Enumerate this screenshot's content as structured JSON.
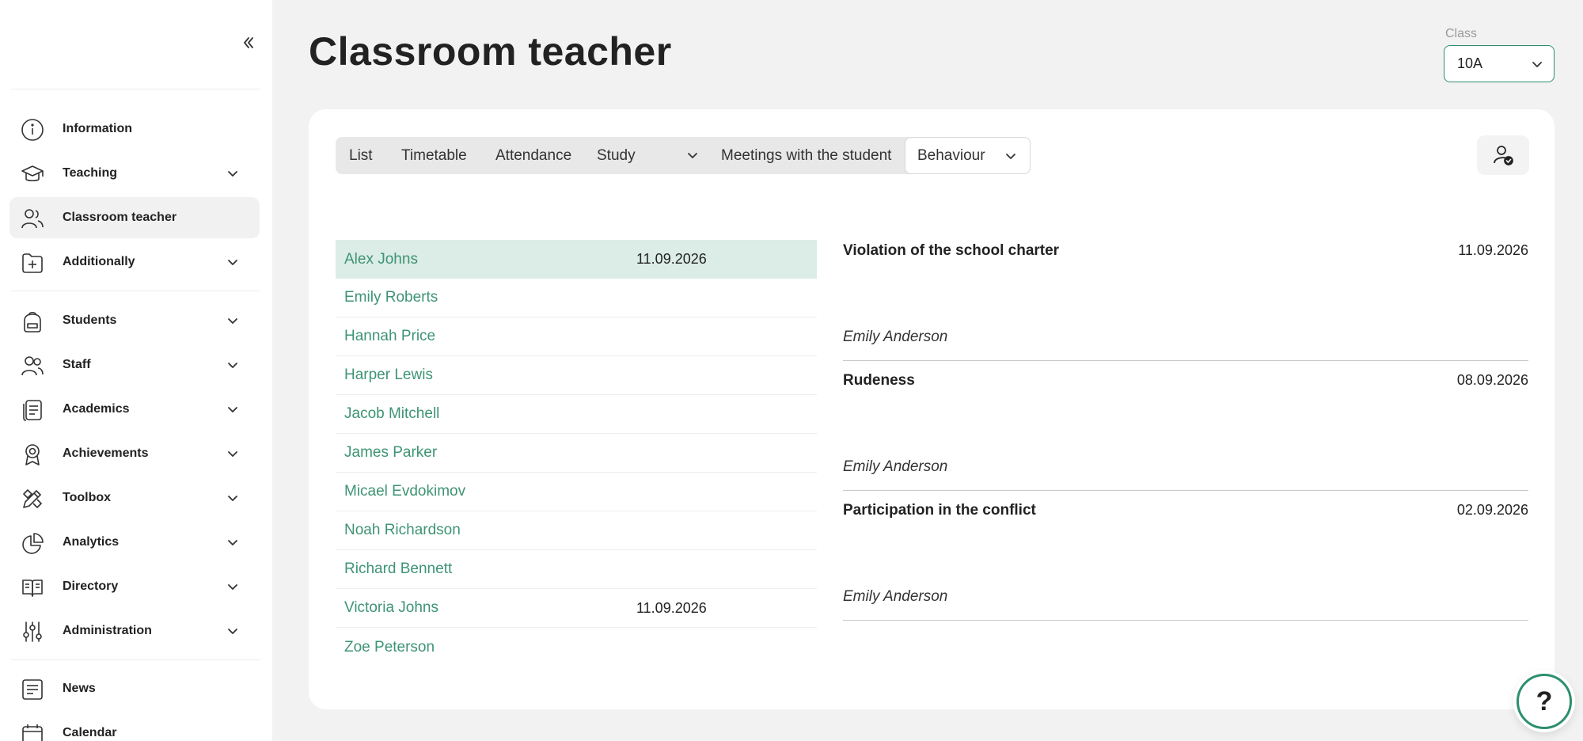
{
  "sidebar": {
    "items": [
      {
        "label": "Information",
        "icon": "info-icon"
      },
      {
        "label": "Teaching",
        "icon": "graduation-cap-icon"
      },
      {
        "label": "Classroom teacher",
        "icon": "classroom-teacher-icon"
      },
      {
        "label": "Additionally",
        "icon": "folder-plus-icon"
      },
      {
        "label": "Students",
        "icon": "backpack-icon"
      },
      {
        "label": "Staff",
        "icon": "users-icon"
      },
      {
        "label": "Academics",
        "icon": "document-icon"
      },
      {
        "label": "Achievements",
        "icon": "award-icon"
      },
      {
        "label": "Toolbox",
        "icon": "tools-icon"
      },
      {
        "label": "Analytics",
        "icon": "pie-chart-icon"
      },
      {
        "label": "Directory",
        "icon": "book-open-icon"
      },
      {
        "label": "Administration",
        "icon": "sliders-icon"
      },
      {
        "label": "News",
        "icon": "news-icon"
      },
      {
        "label": "Calendar",
        "icon": "calendar-icon"
      }
    ]
  },
  "header": {
    "title": "Classroom teacher",
    "class_label": "Class",
    "class_value": "10A"
  },
  "tabs": {
    "list": "List",
    "timetable": "Timetable",
    "attendance": "Attendance",
    "study": "Study",
    "meetings": "Meetings with the student",
    "behaviour": "Behaviour"
  },
  "students": [
    {
      "name": "Alex Johns",
      "date": "11.09.2026"
    },
    {
      "name": "Emily Roberts",
      "date": ""
    },
    {
      "name": "Hannah Price",
      "date": ""
    },
    {
      "name": "Harper Lewis",
      "date": ""
    },
    {
      "name": "Jacob Mitchell",
      "date": ""
    },
    {
      "name": "James Parker",
      "date": ""
    },
    {
      "name": "Micael Evdokimov",
      "date": ""
    },
    {
      "name": "Noah Richardson",
      "date": ""
    },
    {
      "name": "Richard Bennett",
      "date": ""
    },
    {
      "name": "Victoria Johns",
      "date": "11.09.2026"
    },
    {
      "name": "Zoe Peterson",
      "date": ""
    }
  ],
  "records": [
    {
      "title": "Violation of the school charter",
      "date": "11.09.2026",
      "author": "Emily Anderson"
    },
    {
      "title": "Rudeness",
      "date": "08.09.2026",
      "author": "Emily Anderson"
    },
    {
      "title": "Participation in the conflict",
      "date": "02.09.2026",
      "author": "Emily Anderson"
    }
  ],
  "help": {
    "label": "?"
  },
  "colors": {
    "accent": "#2e8f6c",
    "student_link": "#3e9474",
    "selected_row": "#dcece7"
  }
}
